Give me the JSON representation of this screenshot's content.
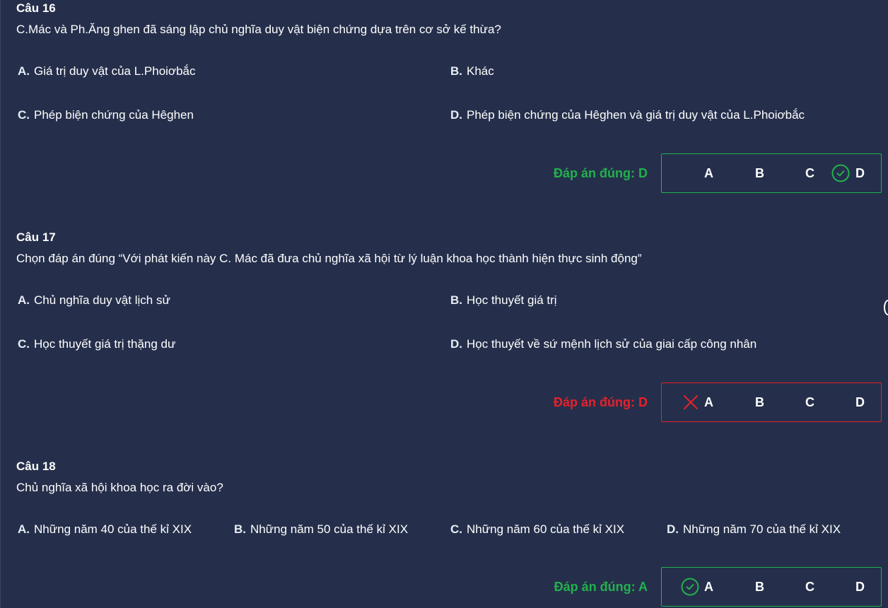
{
  "questions": [
    {
      "title": "Câu 16",
      "text": "C.Mác và Ph.Ăng ghen đã sáng lập chủ nghĩa duy vật biện chứng dựa trên cơ sở kế thừa?",
      "options": [
        {
          "letter": "A.",
          "text": "Giá trị duy vật của L.Phoiơbắc"
        },
        {
          "letter": "B.",
          "text": "Khác"
        },
        {
          "letter": "C.",
          "text": "Phép biện chứng của Hêghen"
        },
        {
          "letter": "D.",
          "text": "Phép biện chứng của Hêghen và giá trị duy vật của L.Phoiơbắc"
        }
      ],
      "answer_label": "Đáp án đúng: D",
      "status": "correct",
      "choices": [
        "A",
        "B",
        "C",
        "D"
      ],
      "marked_choice": "D",
      "mark_icon": "check-circle-icon"
    },
    {
      "title": "Câu 17",
      "text": "Chọn đáp án đúng “Với phát kiến này C. Mác đã đưa chủ nghĩa xã hội từ lý luận khoa học thành hiện thực sinh động”",
      "options": [
        {
          "letter": "A.",
          "text": "Chủ nghĩa duy vật lịch sử"
        },
        {
          "letter": "B.",
          "text": "Học thuyết giá trị"
        },
        {
          "letter": "C.",
          "text": "Học thuyết giá trị thặng dư"
        },
        {
          "letter": "D.",
          "text": "Học thuyết về sứ mệnh lịch sử của giai cấp công nhân"
        }
      ],
      "answer_label": "Đáp án đúng: D",
      "status": "wrong",
      "choices": [
        "A",
        "B",
        "C",
        "D"
      ],
      "marked_choice": "A",
      "mark_icon": "x-icon"
    },
    {
      "title": "Câu 18",
      "text": "Chủ nghĩa xã hội khoa học ra đời vào?",
      "options": [
        {
          "letter": "A.",
          "text": "Những năm 40 của thế kỉ XIX"
        },
        {
          "letter": "B.",
          "text": "Những năm 50 của thế kỉ XIX"
        },
        {
          "letter": "C.",
          "text": "Những năm 60 của thế kỉ XIX"
        },
        {
          "letter": "D.",
          "text": "Những năm 70 của thế kỉ XIX"
        }
      ],
      "answer_label": "Đáp án đúng: A",
      "status": "correct",
      "choices": [
        "A",
        "B",
        "C",
        "D"
      ],
      "marked_choice": "A",
      "mark_icon": "check-circle-icon"
    }
  ],
  "colors": {
    "background": "#252f4b",
    "correct": "#22b14c",
    "wrong": "#e8202a",
    "text": "#ffffff"
  }
}
